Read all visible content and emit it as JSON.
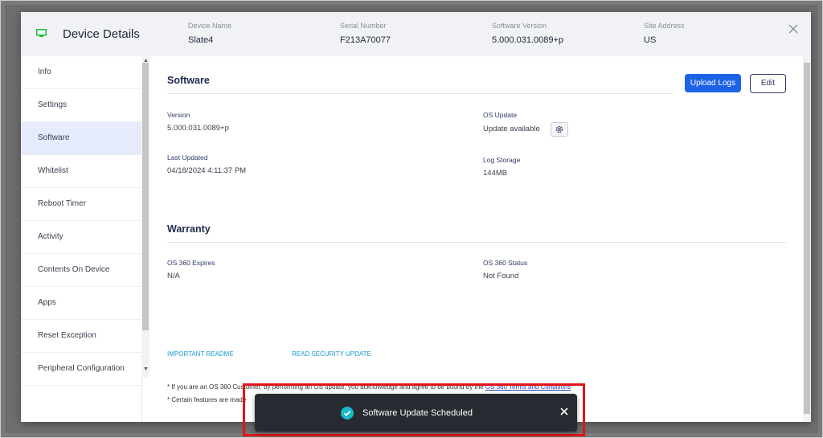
{
  "header": {
    "title": "Device Details",
    "device_name_label": "Device Name",
    "device_name": "Slate4",
    "serial_label": "Serial Number",
    "serial": "F213A70077",
    "software_version_label": "Software Version",
    "software_version": "5.000.031.0089+p",
    "site_label": "Site Address",
    "site": "US"
  },
  "sidebar": {
    "items": [
      {
        "label": "Info"
      },
      {
        "label": "Settings"
      },
      {
        "label": "Software"
      },
      {
        "label": "Whitelist"
      },
      {
        "label": "Reboot Timer"
      },
      {
        "label": "Activity"
      },
      {
        "label": "Contents On Device"
      },
      {
        "label": "Apps"
      },
      {
        "label": "Reset Exception"
      },
      {
        "label": "Peripheral Configuration"
      }
    ],
    "active": "Software"
  },
  "software": {
    "title": "Software",
    "upload_logs": "Upload Logs",
    "edit": "Edit",
    "version_label": "Version",
    "version": "5.000.031.0089+p",
    "os_update_label": "OS Update",
    "os_update": "Update available",
    "last_updated_label": "Last Updated",
    "last_updated": "04/18/2024 4:11:37 PM",
    "log_storage_label": "Log Storage",
    "log_storage": "144MB"
  },
  "warranty": {
    "title": "Warranty",
    "expires_label": "OS 360 Expires",
    "expires": "N/A",
    "status_label": "OS 360 Status",
    "status": "Not Found"
  },
  "links": {
    "readme": "IMPORTANT README",
    "security": "READ SECURITY UPDATE"
  },
  "footnotes": {
    "line1_prefix": "* If you are an OS 360 Customer, by performing an OS update, you acknowledge and agree to be bound by the",
    "line1_link": "OS 360 Terms and Conditions",
    "line2": "* Certain features are made"
  },
  "toast": {
    "message": "Software Update Scheduled"
  },
  "colors": {
    "accent": "#1d63e8",
    "toast_bg": "#272a30",
    "success": "#19b7c8",
    "highlight": "#e0141b"
  }
}
